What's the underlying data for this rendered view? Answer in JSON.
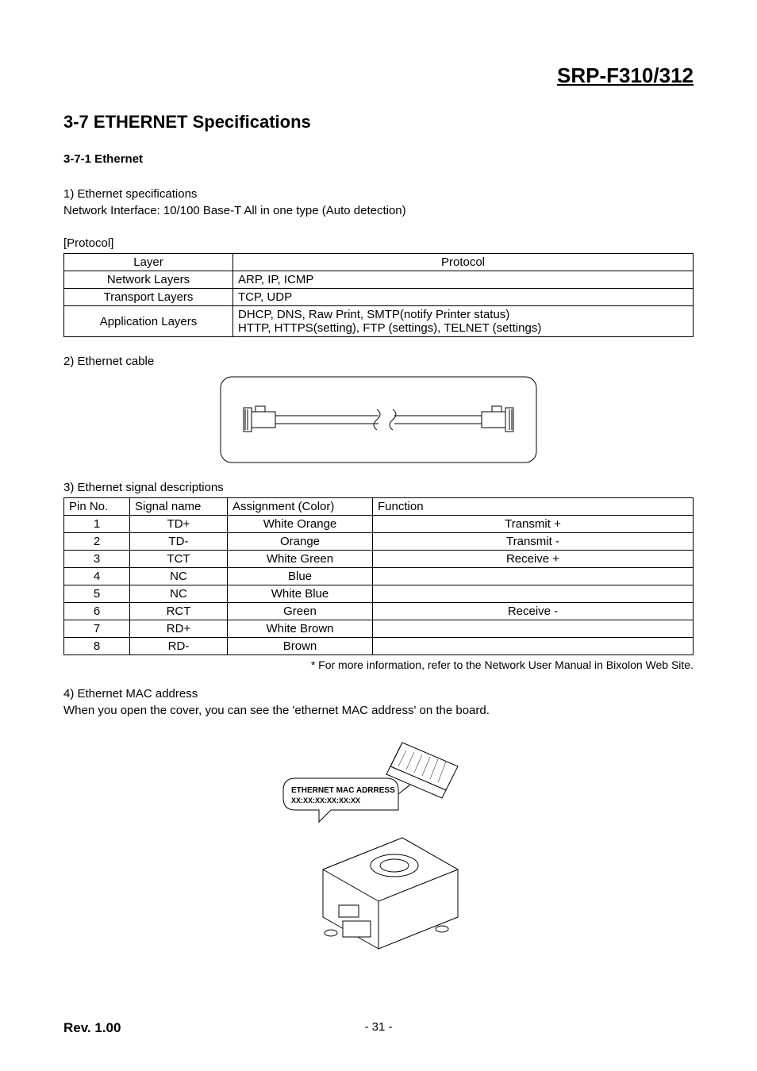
{
  "header": {
    "product": "SRP-F310/312"
  },
  "section": {
    "title": "3-7 ETHERNET Specifications"
  },
  "sub1": {
    "title": "3-7-1 Ethernet",
    "p1_line1": "1) Ethernet specifications",
    "p1_line2": "Network Interface: 10/100 Base-T All in one type (Auto detection)",
    "protocol_label": "[Protocol]"
  },
  "protocol_table": {
    "h_layer": "Layer",
    "h_protocol": "Protocol",
    "rows": [
      {
        "layer": "Network Layers",
        "protocol": "ARP, IP, ICMP"
      },
      {
        "layer": "Transport Layers",
        "protocol": "TCP, UDP"
      },
      {
        "layer": "Application Layers",
        "protocol_l1": "DHCP, DNS, Raw Print, SMTP(notify Printer status)",
        "protocol_l2": "HTTP, HTTPS(setting), FTP (settings), TELNET (settings)"
      }
    ]
  },
  "cable": {
    "title": "2) Ethernet cable"
  },
  "signal": {
    "title": "3) Ethernet signal descriptions",
    "h_pin": "Pin No.",
    "h_signal": "Signal name",
    "h_assign": "Assignment (Color)",
    "h_func": "Function",
    "rows": [
      {
        "pin": "1",
        "name": "TD+",
        "color": "White Orange",
        "func": "Transmit +"
      },
      {
        "pin": "2",
        "name": "TD-",
        "color": "Orange",
        "func": "Transmit -"
      },
      {
        "pin": "3",
        "name": "TCT",
        "color": "White Green",
        "func": "Receive +"
      },
      {
        "pin": "4",
        "name": "NC",
        "color": "Blue",
        "func": ""
      },
      {
        "pin": "5",
        "name": "NC",
        "color": "White Blue",
        "func": ""
      },
      {
        "pin": "6",
        "name": "RCT",
        "color": "Green",
        "func": "Receive -"
      },
      {
        "pin": "7",
        "name": "RD+",
        "color": "White Brown",
        "func": ""
      },
      {
        "pin": "8",
        "name": "RD-",
        "color": "Brown",
        "func": ""
      }
    ],
    "footnote": "* For more information, refer to the Network User Manual in Bixolon Web Site."
  },
  "mac": {
    "title": "4) Ethernet MAC address",
    "desc": "When you open the cover, you can see the 'ethernet MAC address' on the board.",
    "label_line1": "ETHERNET MAC ADRRESS",
    "label_line2": "XX:XX:XX:XX:XX:XX"
  },
  "footer": {
    "rev": "Rev. 1.00",
    "page": "- 31 -"
  }
}
